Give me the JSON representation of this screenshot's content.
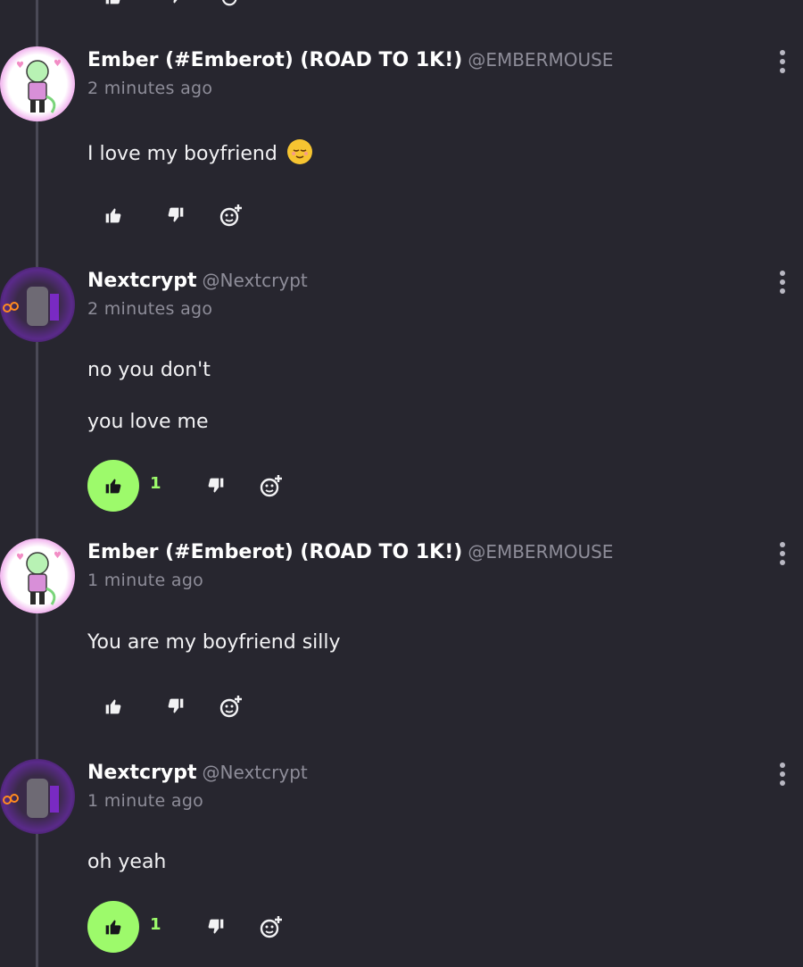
{
  "comments": [
    {
      "author": "Ember (#Emberot) (ROAD TO 1K!)",
      "handle": "@EMBERMOUSE",
      "time": "2 minutes ago",
      "lines": [
        "I love my boyfriend"
      ],
      "emoji": "relieved-face",
      "likes": null
    },
    {
      "author": "Nextcrypt",
      "handle": "@Nextcrypt",
      "time": "2 minutes ago",
      "lines": [
        "no you don't",
        "you love me"
      ],
      "likes": "1"
    },
    {
      "author": "Ember (#Emberot) (ROAD TO 1K!)",
      "handle": "@EMBERMOUSE",
      "time": "1 minute ago",
      "lines": [
        "You are my boyfriend silly"
      ],
      "likes": null
    },
    {
      "author": "Nextcrypt",
      "handle": "@Nextcrypt",
      "time": "1 minute ago",
      "lines": [
        "oh yeah"
      ],
      "likes": "1"
    }
  ],
  "icons": {
    "like": "thumbs-up-icon",
    "dislike": "thumbs-down-icon",
    "react": "add-reaction-icon",
    "more": "more-vertical-icon"
  },
  "colors": {
    "background": "#27262f",
    "accent_like": "#9dfa6b",
    "muted_text": "#8e8d99",
    "ember_avatar_glow": "#e02bd6",
    "nextcrypt_avatar_glow": "#8a2be2"
  }
}
